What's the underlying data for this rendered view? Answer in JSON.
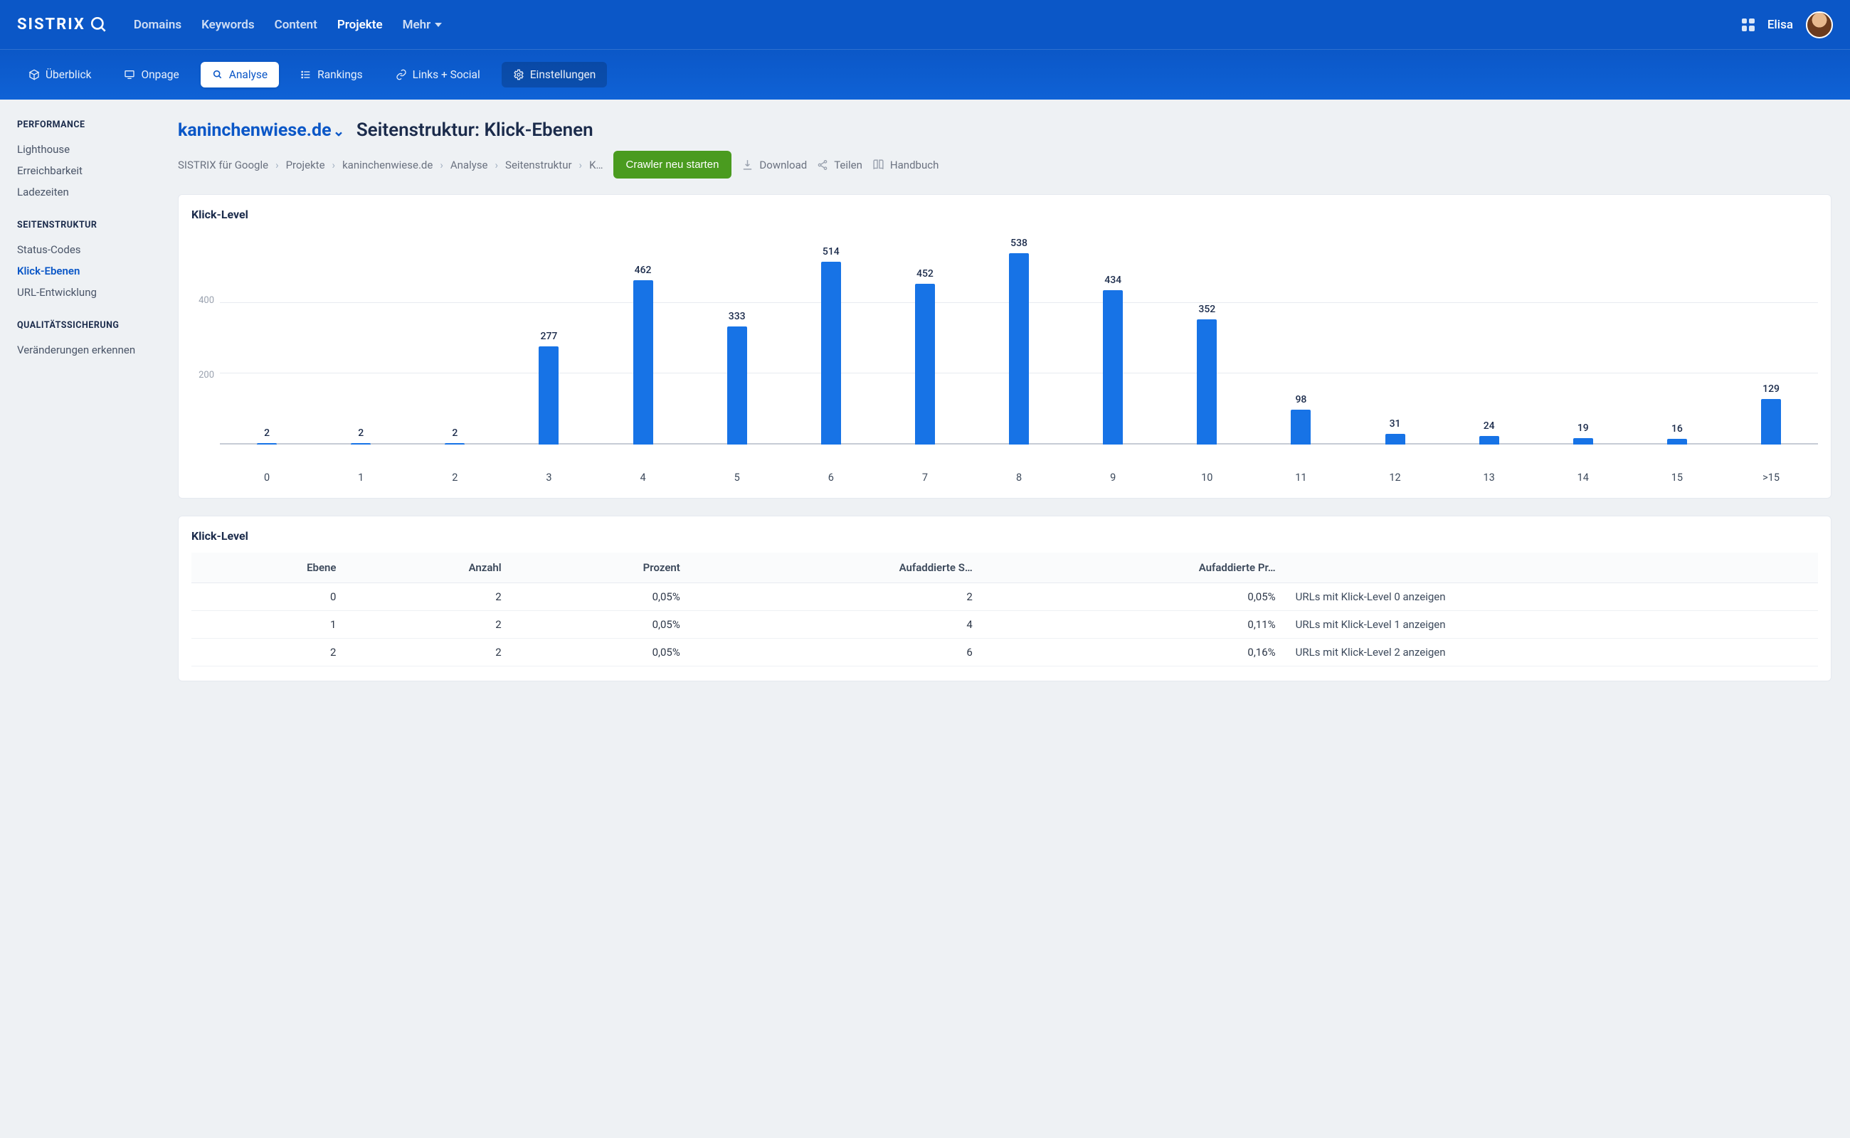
{
  "brand": "SISTRIX",
  "nav": {
    "domains": "Domains",
    "keywords": "Keywords",
    "content": "Content",
    "projekte": "Projekte",
    "mehr": "Mehr"
  },
  "user": {
    "name": "Elisa"
  },
  "tabs": {
    "uberblick": "Überblick",
    "onpage": "Onpage",
    "analyse": "Analyse",
    "rankings": "Rankings",
    "links": "Links + Social",
    "einstellungen": "Einstellungen"
  },
  "sidebar": {
    "group1_title": "PERFORMANCE",
    "group1": [
      "Lighthouse",
      "Erreichbarkeit",
      "Ladezeiten"
    ],
    "group2_title": "SEITENSTRUKTUR",
    "group2": [
      "Status-Codes",
      "Klick-Ebenen",
      "URL-Entwicklung"
    ],
    "group3_title": "QUALITÄTSSICHERUNG",
    "group3": [
      "Veränderungen erkennen"
    ]
  },
  "page": {
    "domain": "kaninchenwiese.de",
    "title": "Seitenstruktur: Klick-Ebenen",
    "breadcrumbs": [
      "SISTRIX für Google",
      "Projekte",
      "kaninchenwiese.de",
      "Analyse",
      "Seitenstruktur",
      "K…"
    ],
    "crawler_btn": "Crawler neu starten",
    "download": "Download",
    "teilen": "Teilen",
    "handbuch": "Handbuch"
  },
  "chart_title": "Klick-Level",
  "chart_data": {
    "type": "bar",
    "title": "Klick-Level",
    "xlabel": "",
    "ylabel": "",
    "ylim": [
      0,
      600
    ],
    "y_ticks": [
      200,
      400
    ],
    "categories": [
      "0",
      "1",
      "2",
      "3",
      "4",
      "5",
      "6",
      "7",
      "8",
      "9",
      "10",
      "11",
      "12",
      "13",
      "14",
      "15",
      ">15"
    ],
    "values": [
      2,
      2,
      2,
      277,
      462,
      333,
      514,
      452,
      538,
      434,
      352,
      98,
      31,
      24,
      19,
      16,
      129
    ]
  },
  "table": {
    "title": "Klick-Level",
    "headers": [
      "Ebene",
      "Anzahl",
      "Prozent",
      "Aufaddierte S…",
      "Aufaddierte Pr…",
      ""
    ],
    "rows": [
      {
        "ebene": "0",
        "anzahl": "2",
        "prozent": "0,05%",
        "sum": "2",
        "sumpct": "0,05%",
        "link": "URLs mit Klick-Level 0 anzeigen"
      },
      {
        "ebene": "1",
        "anzahl": "2",
        "prozent": "0,05%",
        "sum": "4",
        "sumpct": "0,11%",
        "link": "URLs mit Klick-Level 1 anzeigen"
      },
      {
        "ebene": "2",
        "anzahl": "2",
        "prozent": "0,05%",
        "sum": "6",
        "sumpct": "0,16%",
        "link": "URLs mit Klick-Level 2 anzeigen"
      }
    ]
  }
}
